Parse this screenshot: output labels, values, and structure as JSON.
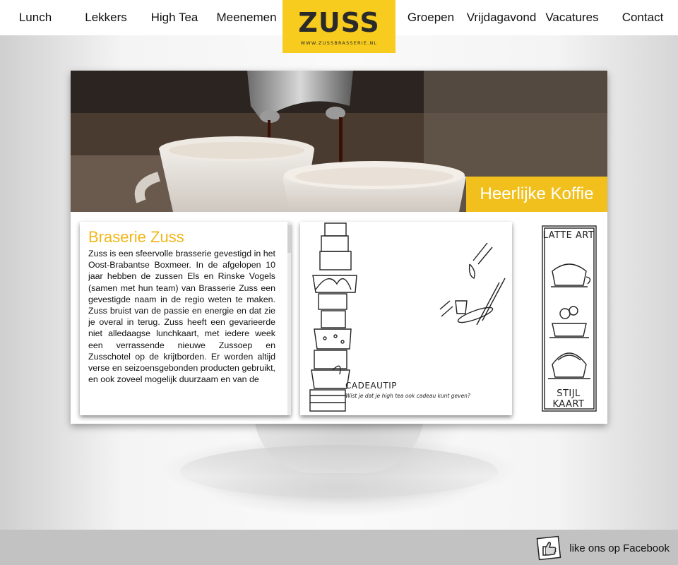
{
  "nav": {
    "left": [
      {
        "label": "Lunch"
      },
      {
        "label": "Lekkers"
      },
      {
        "label": "High Tea"
      },
      {
        "label": "Meenemen"
      }
    ],
    "right": [
      {
        "label": "Groepen"
      },
      {
        "label": "Vrijdagavond"
      },
      {
        "label": "Vacatures"
      },
      {
        "label": "Contact"
      }
    ]
  },
  "logo": {
    "mark": "ZUSS",
    "url": "WWW.ZUSSBRASSERIE.NL"
  },
  "hero": {
    "caption": "Heerlijke Koffie"
  },
  "article": {
    "title": "Braserie Zuss",
    "body": "Zuss is een sfeervolle brasserie gevestigd in het Oost-Brabantse Boxmeer. In de afgelopen 10 jaar hebben de zussen Els en Rinske Vogels (samen met hun team) van Brasserie Zuss een gevestigde naam in de regio weten te maken. Zuss bruist van de passie en energie en dat zie je overal in terug. Zuss heeft een gevarieerde niet alledaagse lunchkaart, met iedere week een verrassende nieuwe Zussoep en Zusschotel op de krijtborden. Er worden altijd verse en seizoensgebonden producten gebruikt, en ook zoveel mogelijk duurzaam en van de"
  },
  "cadeau": {
    "label": "CADEAUTIP",
    "sub": "Wist je dat je high tea ook cadeau kunt geven?"
  },
  "latte": {
    "title": "LATTE ART",
    "footer": "STIJL KAART"
  },
  "footer": {
    "facebook_label": "like ons op Facebook"
  },
  "colors": {
    "accent": "#f8cc1e",
    "footer": "#c2c2c2"
  }
}
